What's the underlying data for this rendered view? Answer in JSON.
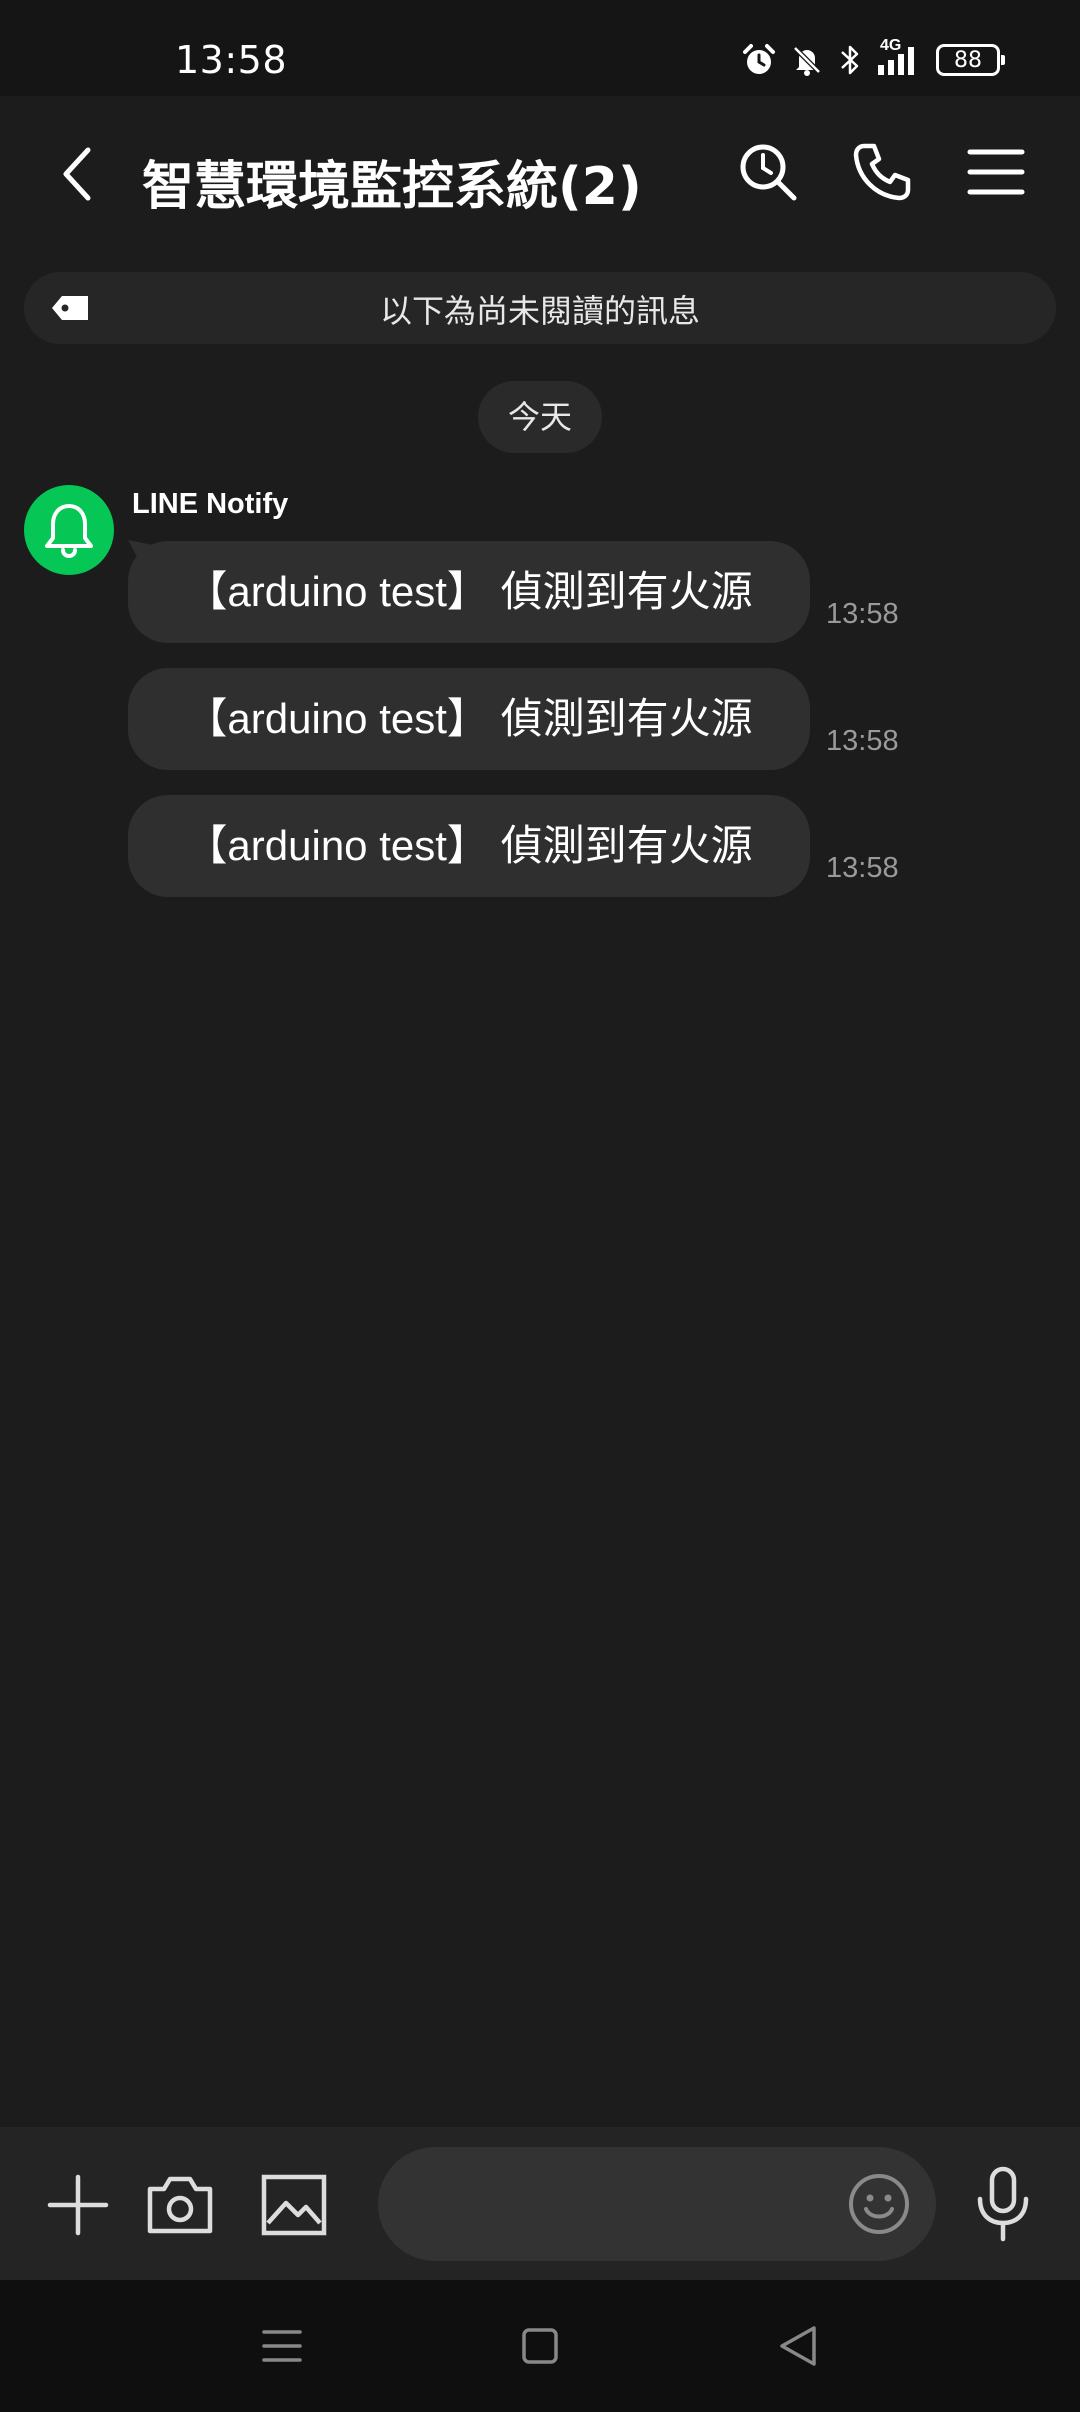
{
  "status_bar": {
    "time": "13:58",
    "network": "4G",
    "battery": "88",
    "icons": [
      "alarm-icon",
      "bell-off-icon",
      "bluetooth-icon",
      "signal-icon",
      "battery-icon"
    ]
  },
  "header": {
    "title": "智慧環境監控系統(2)",
    "icons": [
      "back-icon",
      "search-icon",
      "call-icon",
      "menu-icon"
    ]
  },
  "unread_banner": {
    "text": "以下為尚未閱讀的訊息",
    "icon": "tag-icon"
  },
  "date_divider": "今天",
  "chat": {
    "sender": {
      "name": "LINE Notify",
      "avatar_icon": "bell-icon",
      "avatar_color": "#06c755"
    },
    "messages": [
      {
        "text": "【arduino test】 偵測到有火源",
        "time": "13:58"
      },
      {
        "text": "【arduino test】 偵測到有火源",
        "time": "13:58"
      },
      {
        "text": "【arduino test】 偵測到有火源",
        "time": "13:58"
      }
    ]
  },
  "input_bar": {
    "value": "",
    "placeholder": "",
    "icons": [
      "plus-icon",
      "camera-icon",
      "image-icon",
      "emoji-icon",
      "mic-icon"
    ]
  },
  "nav_bar": {
    "icons": [
      "recents-icon",
      "home-icon",
      "back-triangle-icon"
    ]
  },
  "colors": {
    "background": "#1c1c1c",
    "bubble": "#2f2f2f",
    "accent_green": "#06c755",
    "timestamp": "#9a9a9a"
  }
}
